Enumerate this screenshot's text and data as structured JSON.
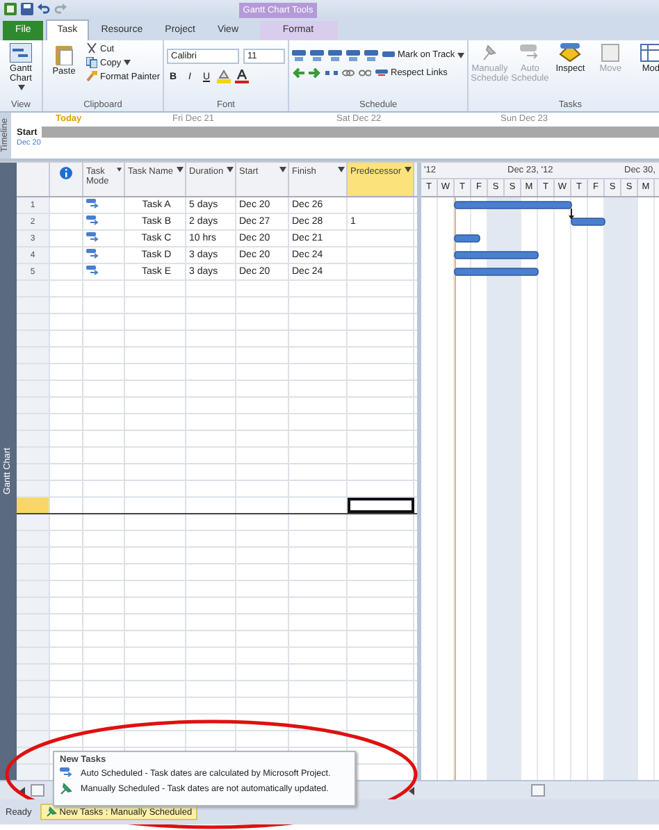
{
  "contextual_tab": {
    "title": "Gantt Chart Tools"
  },
  "tabs": [
    {
      "label": "File",
      "kind": "file",
      "selected": false
    },
    {
      "label": "Task",
      "kind": "tab",
      "selected": true
    },
    {
      "label": "Resource",
      "kind": "tab",
      "selected": false
    },
    {
      "label": "Project",
      "kind": "tab",
      "selected": false
    },
    {
      "label": "View",
      "kind": "tab",
      "selected": false
    },
    {
      "label": "Format",
      "kind": "context",
      "selected": false
    }
  ],
  "ribbon": {
    "view_group": {
      "label": "View",
      "button": "Gantt Chart"
    },
    "clipboard_group": {
      "label": "Clipboard",
      "paste": "Paste",
      "cut": "Cut",
      "copy": "Copy",
      "format_painter": "Format Painter"
    },
    "font_group": {
      "label": "Font",
      "font": "Calibri",
      "size": "11",
      "bold": "B",
      "italic": "I",
      "underline": "U"
    },
    "schedule_group": {
      "label": "Schedule",
      "mark_on_track": "Mark on Track",
      "respect_links": "Respect Links"
    },
    "tasks_group": {
      "label": "Tasks",
      "commands": [
        {
          "label": "Manually Schedule",
          "kind": "pin",
          "disabled": true
        },
        {
          "label": "Auto Schedule",
          "kind": "auto",
          "disabled": true
        },
        {
          "label": "Inspect",
          "kind": "inspect",
          "disabled": false
        },
        {
          "label": "Move",
          "kind": "move",
          "disabled": true
        },
        {
          "label": "Mod",
          "kind": "mode",
          "disabled": false
        }
      ]
    }
  },
  "timeline": {
    "side_label": "Timeline",
    "today": "Today",
    "dates": [
      "Fri Dec 21",
      "Sat Dec 22",
      "Sun Dec 23"
    ],
    "start_label": "Start",
    "start_date": "Dec 20"
  },
  "view_label": "Gantt Chart",
  "table": {
    "columns": [
      {
        "label": "Task Mode",
        "selected": false
      },
      {
        "label": "Task Name",
        "selected": false
      },
      {
        "label": "Duration",
        "selected": false
      },
      {
        "label": "Start",
        "selected": false
      },
      {
        "label": "Finish",
        "selected": false
      },
      {
        "label": "Predecessor",
        "selected": true
      }
    ],
    "rows": [
      {
        "id": "1",
        "name": "Task A",
        "duration": "5 days",
        "start": "Dec 20",
        "finish": "Dec 26",
        "predecessors": ""
      },
      {
        "id": "2",
        "name": "Task B",
        "duration": "2 days",
        "start": "Dec 27",
        "finish": "Dec 28",
        "predecessors": "1"
      },
      {
        "id": "3",
        "name": "Task C",
        "duration": "10 hrs",
        "start": "Dec 20",
        "finish": "Dec 21",
        "predecessors": ""
      },
      {
        "id": "4",
        "name": "Task D",
        "duration": "3 days",
        "start": "Dec 20",
        "finish": "Dec 24",
        "predecessors": ""
      },
      {
        "id": "5",
        "name": "Task E",
        "duration": "3 days",
        "start": "Dec 20",
        "finish": "Dec 24",
        "predecessors": ""
      }
    ],
    "blank_rows": [
      {
        "selected": false
      },
      {
        "selected": false
      },
      {
        "selected": false
      },
      {
        "selected": false
      },
      {
        "selected": false
      },
      {
        "selected": false
      },
      {
        "selected": false
      },
      {
        "selected": false
      },
      {
        "selected": false
      },
      {
        "selected": false
      },
      {
        "selected": false
      },
      {
        "selected": false
      },
      {
        "selected": false
      },
      {
        "selected": true
      },
      {
        "selected": false
      },
      {
        "selected": false
      },
      {
        "selected": false
      },
      {
        "selected": false
      },
      {
        "selected": false
      },
      {
        "selected": false
      },
      {
        "selected": false
      },
      {
        "selected": false
      },
      {
        "selected": false
      },
      {
        "selected": false
      },
      {
        "selected": false
      },
      {
        "selected": false
      },
      {
        "selected": false
      },
      {
        "selected": false
      },
      {
        "selected": false
      },
      {
        "selected": false
      }
    ]
  },
  "gantt": {
    "weeks": [
      "'12",
      "Dec 23, '12",
      "Dec 30,"
    ],
    "days": [
      {
        "label": "T",
        "weekend": false
      },
      {
        "label": "W",
        "weekend": false
      },
      {
        "label": "T",
        "weekend": false
      },
      {
        "label": "F",
        "weekend": false
      },
      {
        "label": "S",
        "weekend": true
      },
      {
        "label": "S",
        "weekend": true
      },
      {
        "label": "M",
        "weekend": false
      },
      {
        "label": "T",
        "weekend": false
      },
      {
        "label": "W",
        "weekend": false
      },
      {
        "label": "T",
        "weekend": false
      },
      {
        "label": "F",
        "weekend": false
      },
      {
        "label": "S",
        "weekend": true
      },
      {
        "label": "S",
        "weekend": true
      },
      {
        "label": "M",
        "weekend": false
      }
    ]
  },
  "popup": {
    "title": "New Tasks",
    "options": [
      {
        "label": "Auto Scheduled - Task dates are calculated by Microsoft Project.",
        "kind": "auto"
      },
      {
        "label": "Manually Scheduled - Task dates are not automatically updated.",
        "kind": "manual"
      }
    ]
  },
  "status_bar": {
    "ready": "Ready",
    "new_tasks": "New Tasks : Manually Scheduled"
  }
}
